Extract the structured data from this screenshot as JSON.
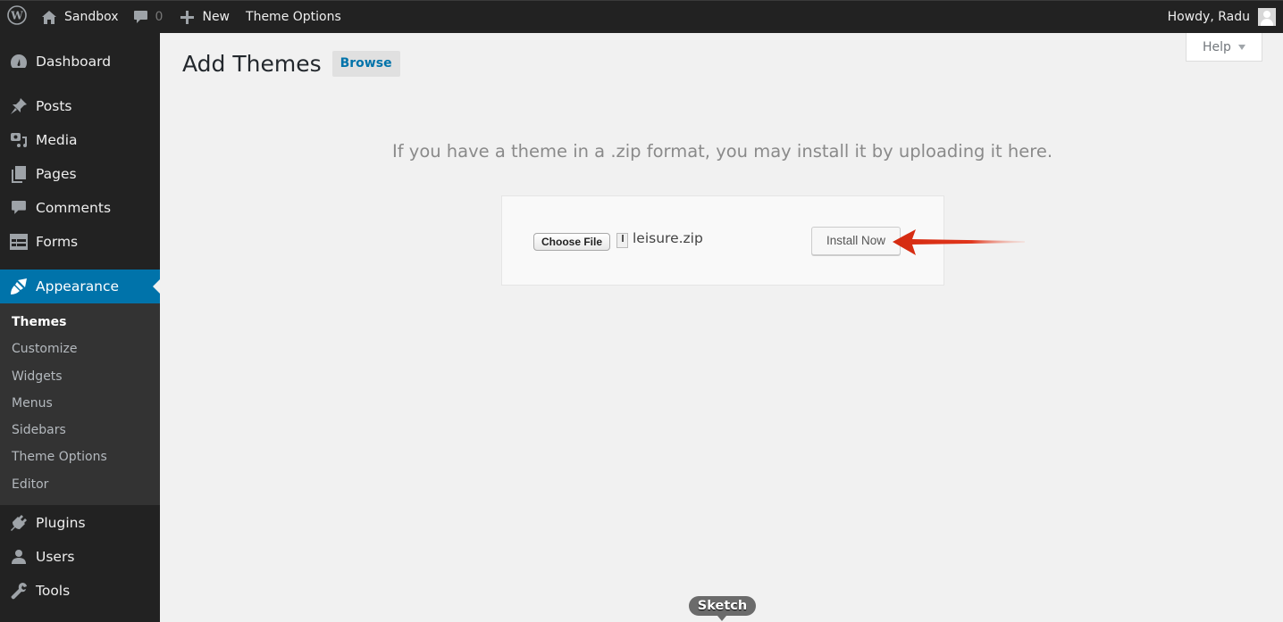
{
  "adminbar": {
    "site_name": "Sandbox",
    "comments_count": "0",
    "new_label": "New",
    "theme_options_label": "Theme Options",
    "greeting": "Howdy, Radu",
    "icons": {
      "wp": "wordpress-logo-icon",
      "home": "home-icon",
      "comments": "comment-bubble-icon",
      "new": "plus-icon",
      "avatar": "user-avatar-icon"
    }
  },
  "sidebar": {
    "items": [
      {
        "label": "Dashboard",
        "icon": "dashboard-icon"
      },
      {
        "label": "Posts",
        "icon": "pin-icon"
      },
      {
        "label": "Media",
        "icon": "media-icon"
      },
      {
        "label": "Pages",
        "icon": "pages-icon"
      },
      {
        "label": "Comments",
        "icon": "comment-icon"
      },
      {
        "label": "Forms",
        "icon": "forms-icon"
      },
      {
        "label": "Appearance",
        "icon": "paintbrush-icon",
        "active": true
      },
      {
        "label": "Plugins",
        "icon": "plug-icon"
      },
      {
        "label": "Users",
        "icon": "user-icon"
      },
      {
        "label": "Tools",
        "icon": "wrench-icon"
      }
    ],
    "appearance_submenu": [
      {
        "label": "Themes",
        "current": true
      },
      {
        "label": "Customize"
      },
      {
        "label": "Widgets"
      },
      {
        "label": "Menus"
      },
      {
        "label": "Sidebars"
      },
      {
        "label": "Theme Options"
      },
      {
        "label": "Editor"
      }
    ]
  },
  "main": {
    "help_label": "Help",
    "page_title": "Add Themes",
    "browse_label": "Browse",
    "upload_description": "If you have a theme in a .zip format, you may install it by uploading it here.",
    "choose_file_label": "Choose File",
    "selected_file": "leisure.zip",
    "install_label": "Install Now"
  },
  "annotation": {
    "arrow_color": "#d9280f",
    "tooltip_label": "Sketch"
  },
  "colors": {
    "adminbar_bg": "#222222",
    "sidebar_bg": "#222222",
    "submenu_bg": "#333333",
    "accent": "#0073aa",
    "content_bg": "#f1f1f1"
  }
}
